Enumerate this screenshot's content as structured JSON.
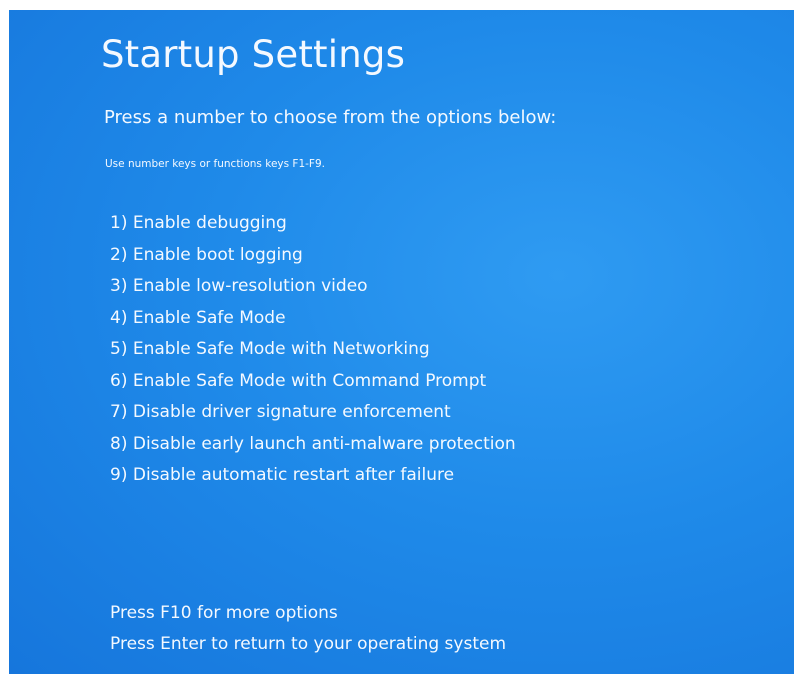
{
  "screen": {
    "title": "Startup Settings",
    "prompt": "Press a number to choose from the options below:",
    "hint": "Use number keys or functions keys F1-F9.",
    "options": [
      {
        "label": "1) Enable debugging"
      },
      {
        "label": "2) Enable boot logging"
      },
      {
        "label": "3) Enable low-resolution video"
      },
      {
        "label": "4) Enable Safe Mode"
      },
      {
        "label": "5) Enable Safe Mode with Networking"
      },
      {
        "label": "6) Enable Safe Mode with Command Prompt"
      },
      {
        "label": "7) Disable driver signature enforcement"
      },
      {
        "label": "8) Disable early launch anti-malware protection"
      },
      {
        "label": "9) Disable automatic restart after failure"
      }
    ],
    "footer": {
      "more_options": "Press F10 for more options",
      "return": "Press Enter to return to your operating system"
    }
  },
  "colors": {
    "background": "#1f8ae9",
    "text": "#f4f9ff",
    "frame": "#ffffff"
  }
}
